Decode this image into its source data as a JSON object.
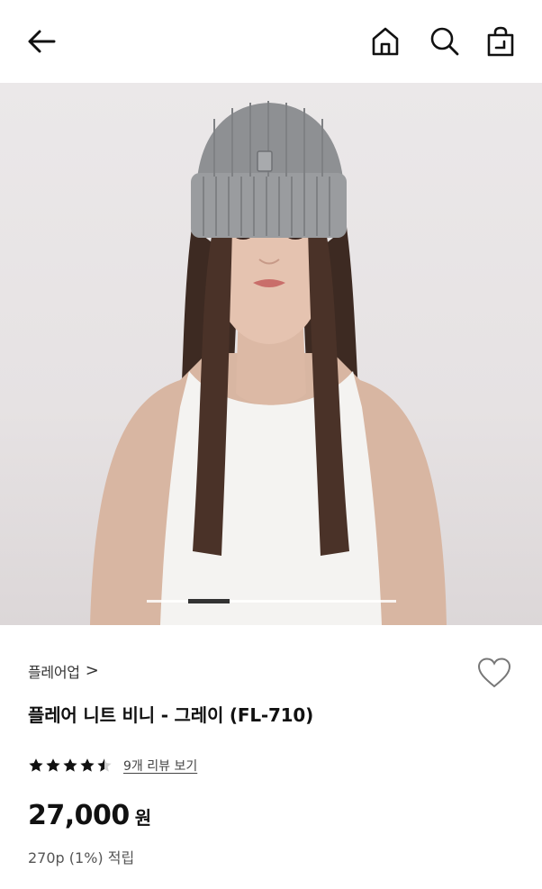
{
  "header": {
    "back_icon": "arrow-left-icon",
    "home_icon": "home-icon",
    "search_icon": "search-icon",
    "cart_icon": "shopping-bag-icon"
  },
  "gallery": {
    "image_description": "product-photo",
    "slide_indicator": {
      "current": 2,
      "total": 6
    }
  },
  "product": {
    "brand": "플레어업",
    "brand_chevron": ">",
    "title": "플레어 니트 비니 - 그레이 (FL-710)",
    "rating": 4.5,
    "rating_max": 5,
    "review_link": "9개 리뷰 보기",
    "price": "27,000",
    "price_unit": "원",
    "points": "270p (1%) 적립",
    "wishlist_icon": "heart-outline-icon"
  },
  "colors": {
    "text_primary": "#111111",
    "text_secondary": "#555555",
    "star": "#111111",
    "beanie": "#8e9093"
  }
}
